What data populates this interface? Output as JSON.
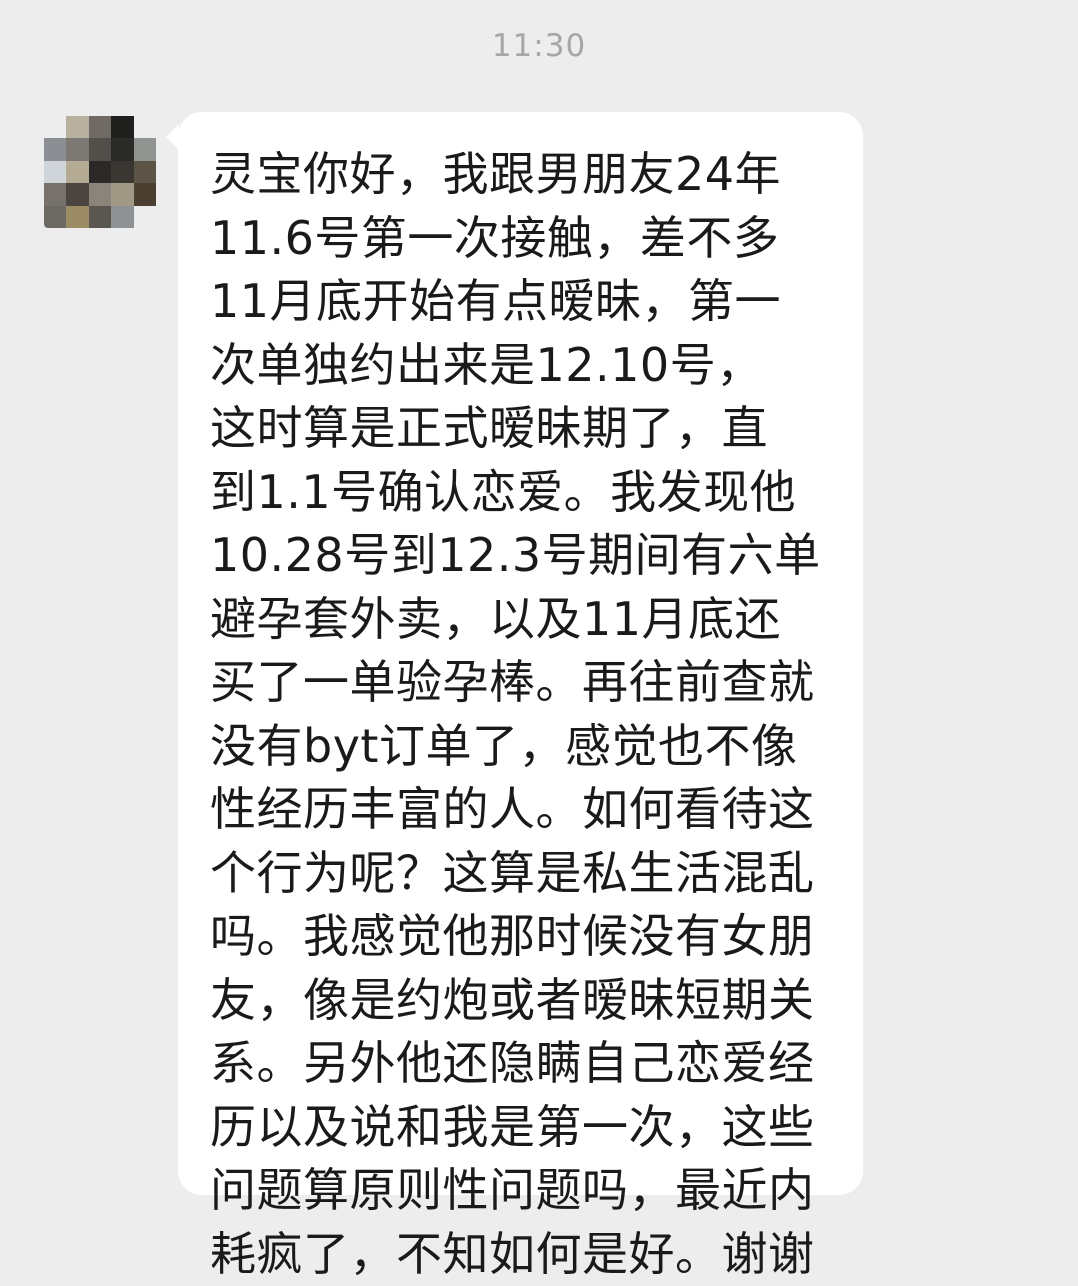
{
  "timestamp": "11:30",
  "sender": {
    "avatar_colors": [
      "#ededed",
      "#b7b09e",
      "#6f6a63",
      "#1f1f1d",
      "#ededed",
      "#8b8f93",
      "#7c7873",
      "#524e4a",
      "#2a2a28",
      "#8f9490",
      "#cfd5d8",
      "#b5ab95",
      "#2b2927",
      "#3a3733",
      "#5b5447",
      "#76716b",
      "#4a4540",
      "#8b847a",
      "#a29886",
      "#4a3f30",
      "#6c6864",
      "#9c8c66",
      "#5a5650",
      "#8e9295",
      "#ededed"
    ]
  },
  "message": {
    "lines": [
      "灵宝你好，我跟男朋友24年",
      "11.6号第一次接触，差不多",
      "11月底开始有点暧昧，第一",
      "次单独约出来是12.10号，",
      "这时算是正式暧昧期了，直",
      "到1.1号确认恋爱。我发现他",
      "10.28号到12.3号期间有六单",
      "避孕套外卖，以及11月底还",
      "买了一单验孕棒。再往前查就",
      "没有byt订单了，感觉也不像",
      "性经历丰富的人。如何看待这",
      "个行为呢？这算是私生活混乱",
      "吗。我感觉他那时候没有女朋",
      "友，像是约炮或者暧昧短期关",
      "系。另外他还隐瞒自己恋爱经",
      "历以及说和我是第一次，这些",
      "问题算原则性问题吗，最近内",
      "耗疯了，不知如何是好。谢谢"
    ]
  }
}
